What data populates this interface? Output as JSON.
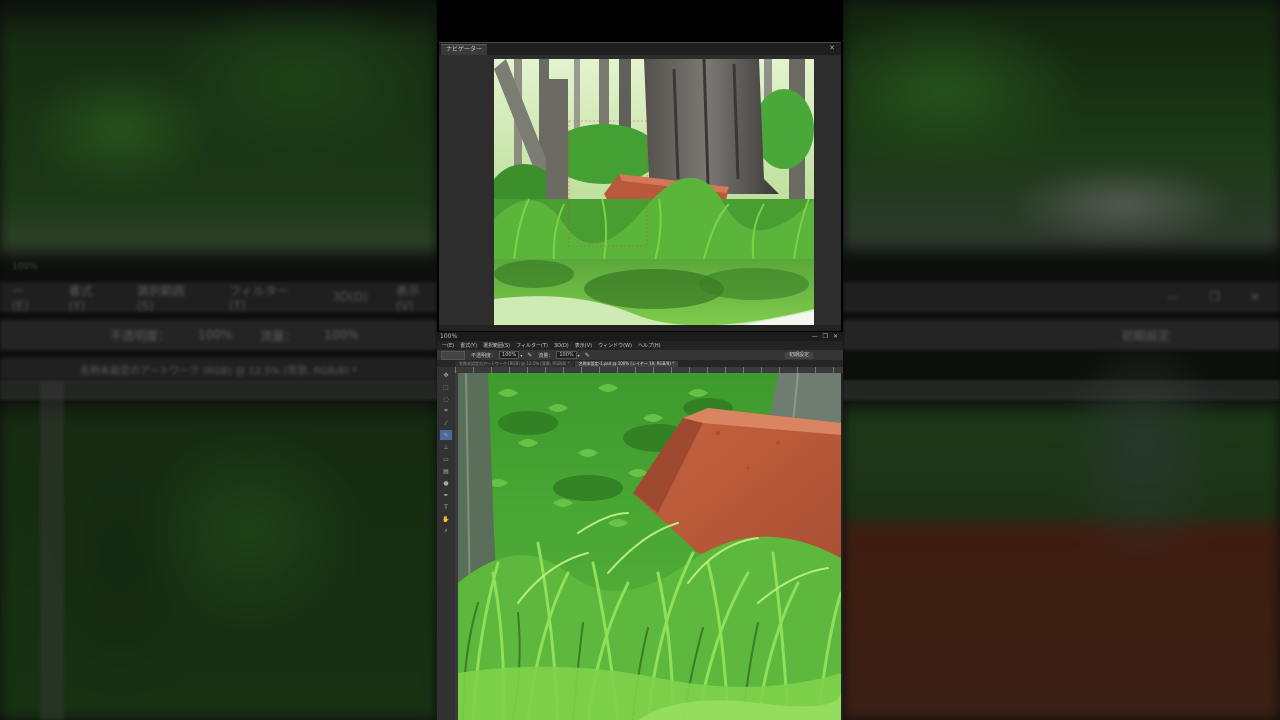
{
  "background": {
    "menu_items": [
      "ー(E)",
      "書式(Y)",
      "選択範囲(S)",
      "フィルター(T)",
      "3D(D)",
      "表示(V)"
    ],
    "options": {
      "opacity_label": "不透明度：",
      "opacity_value": "100%",
      "flow_label": "流量：",
      "flow_value": "100%"
    },
    "tab_text": "名称未設定のアートワーク (RGB) @ 12.5% (背景, RGB/8) *",
    "zoom": "100%",
    "workspace_label": "初期設定"
  },
  "navigator": {
    "tab_label": "ナビゲーター",
    "close_label": "✕"
  },
  "window": {
    "zoom_readout": "100%",
    "controls": [
      "—",
      "❐",
      "✕"
    ],
    "menu_items": [
      "ー(E)",
      "書式(Y)",
      "選択範囲(S)",
      "フィルター(T)",
      "3D(D)",
      "表示(V)",
      "ウィンドウ(W)",
      "ヘルプ(H)"
    ],
    "options": {
      "opacity_label": "不透明度：",
      "opacity_value": "100%",
      "flow_label": "流量：",
      "flow_value": "100%",
      "workspace": "初期設定"
    },
    "tabs": [
      {
        "label": "名称未設定のアートワーク (RGB) @ 12.5% (背景, RGB/8) *",
        "active": false
      },
      {
        "label": "名称未設定-1.psd @ 100% (レイヤー 19, RGB/8) *",
        "active": true
      }
    ]
  },
  "colors": {
    "grass_light": "#7fd24a",
    "grass_dark": "#2f6b1e",
    "rock": "#b9583a",
    "ui_dark": "#2b2b2b"
  },
  "icons": [
    "brush-icon",
    "pressure-icon",
    "close-icon",
    "minimize-icon",
    "restore-icon"
  ]
}
